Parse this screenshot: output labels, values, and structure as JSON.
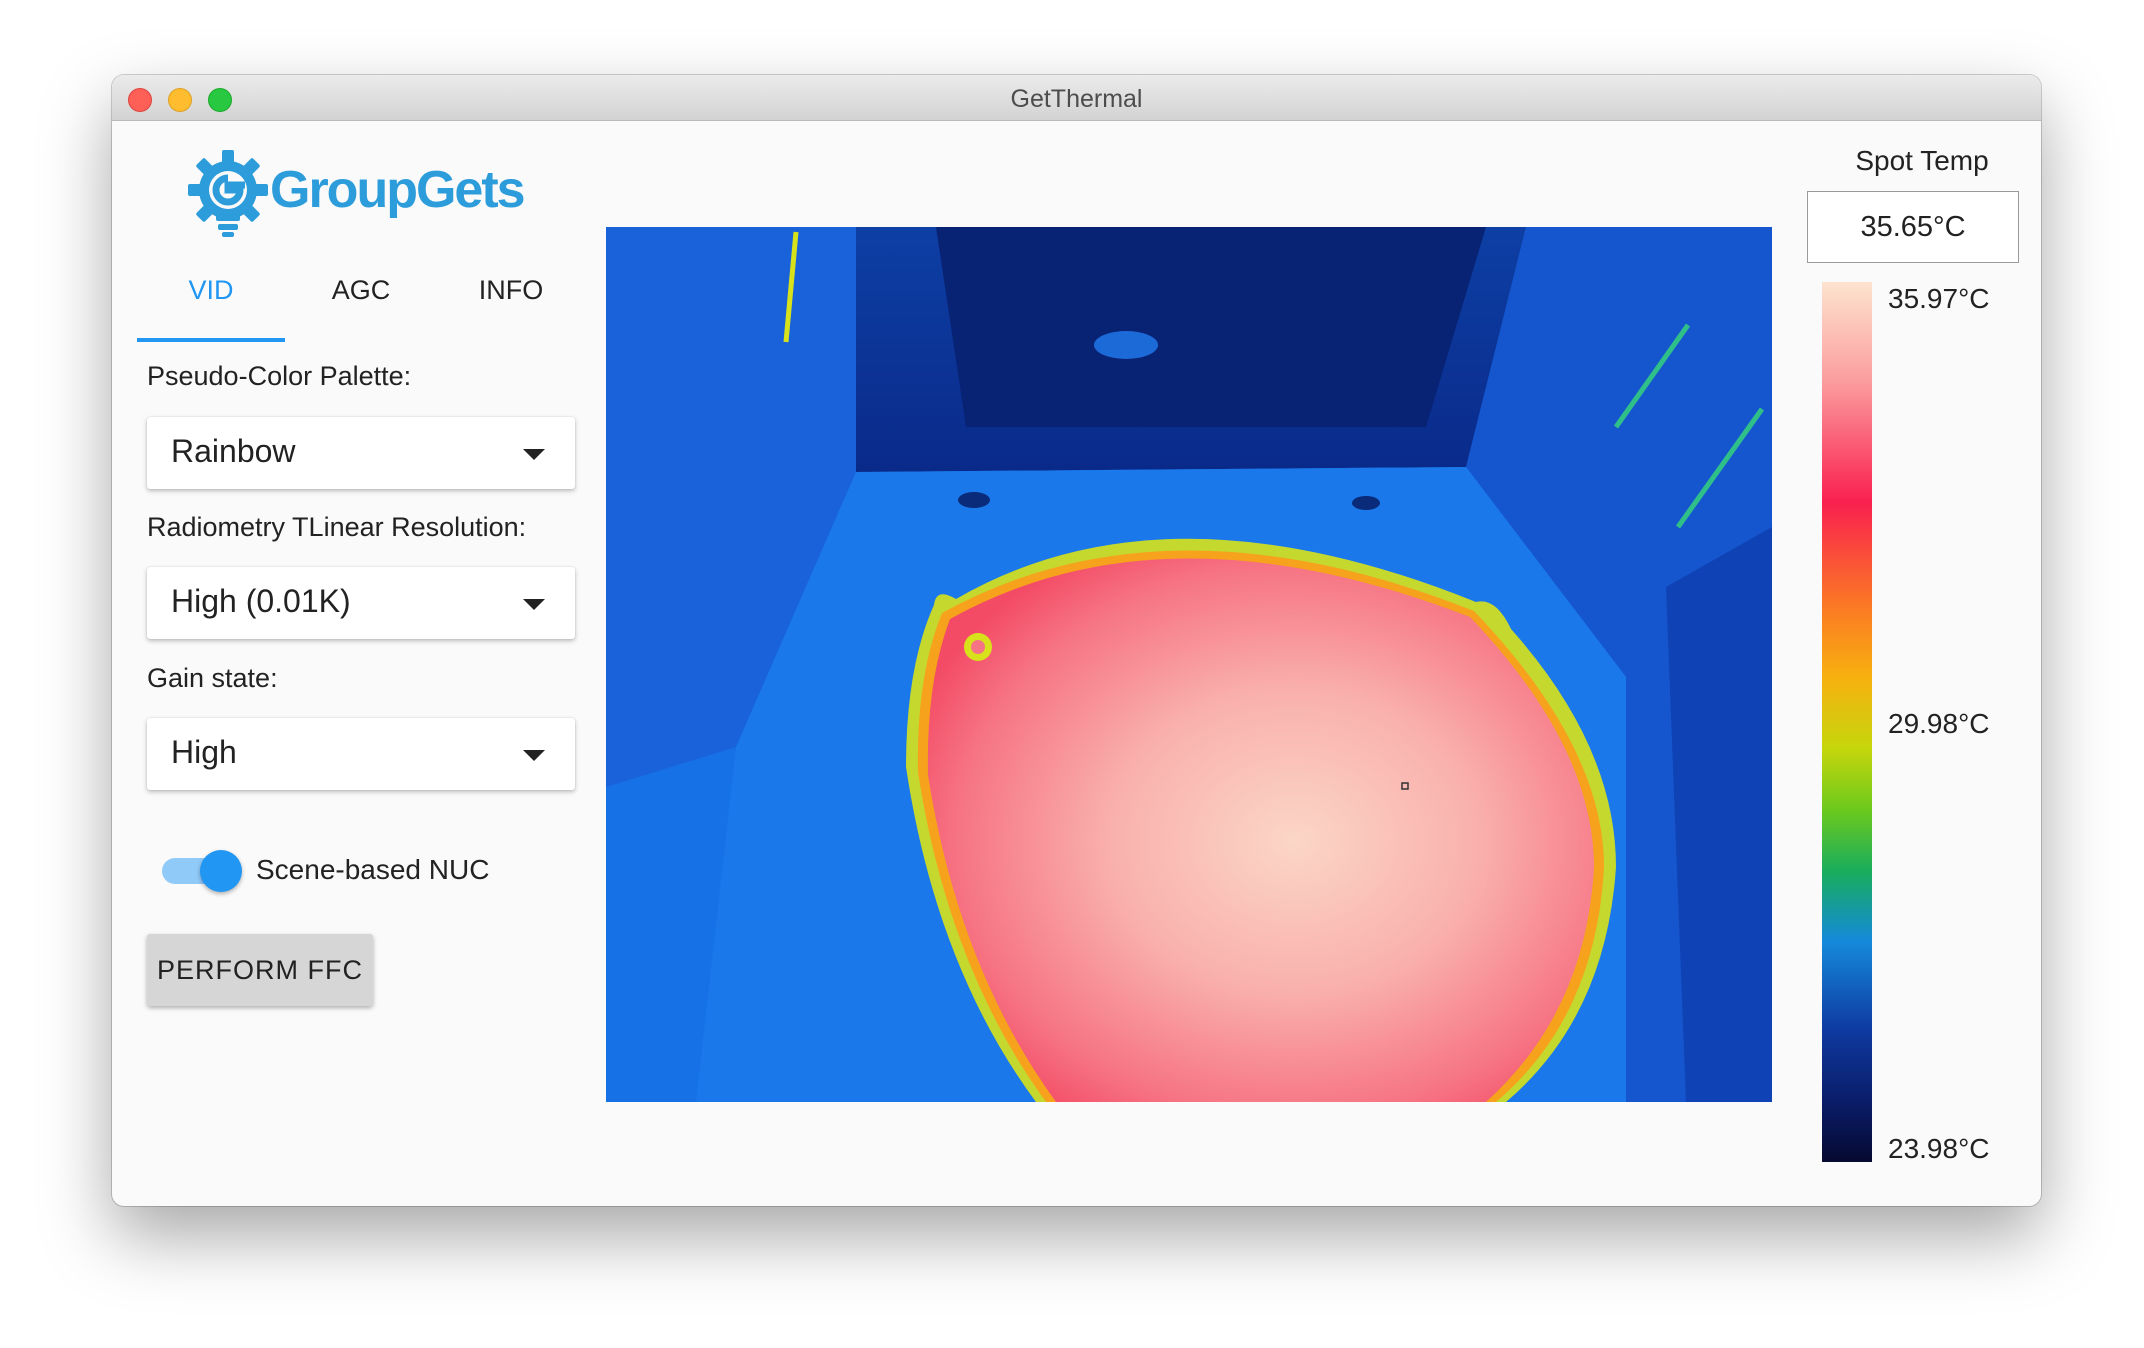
{
  "window": {
    "title": "GetThermal"
  },
  "logo": {
    "text": "GroupGets"
  },
  "tabs": [
    {
      "label": "VID",
      "active": true
    },
    {
      "label": "AGC",
      "active": false
    },
    {
      "label": "INFO",
      "active": false
    }
  ],
  "controls": {
    "palette_label": "Pseudo-Color Palette:",
    "palette_value": "Rainbow",
    "resolution_label": "Radiometry TLinear Resolution:",
    "resolution_value": "High (0.01K)",
    "gain_label": "Gain state:",
    "gain_value": "High",
    "nuc_label": "Scene-based NUC",
    "nuc_enabled": true,
    "ffc_button": "PERFORM FFC"
  },
  "spot": {
    "title": "Spot Temp",
    "value": "35.65°C"
  },
  "scale": {
    "max": "35.97°C",
    "mid": "29.98°C",
    "min": "23.98°C"
  },
  "colors": {
    "accent": "#2196f3",
    "logo_blue": "#2c9cdb"
  },
  "icons": {
    "logo": "gear-lightbulb-icon",
    "dropdown": "caret-down-icon"
  }
}
